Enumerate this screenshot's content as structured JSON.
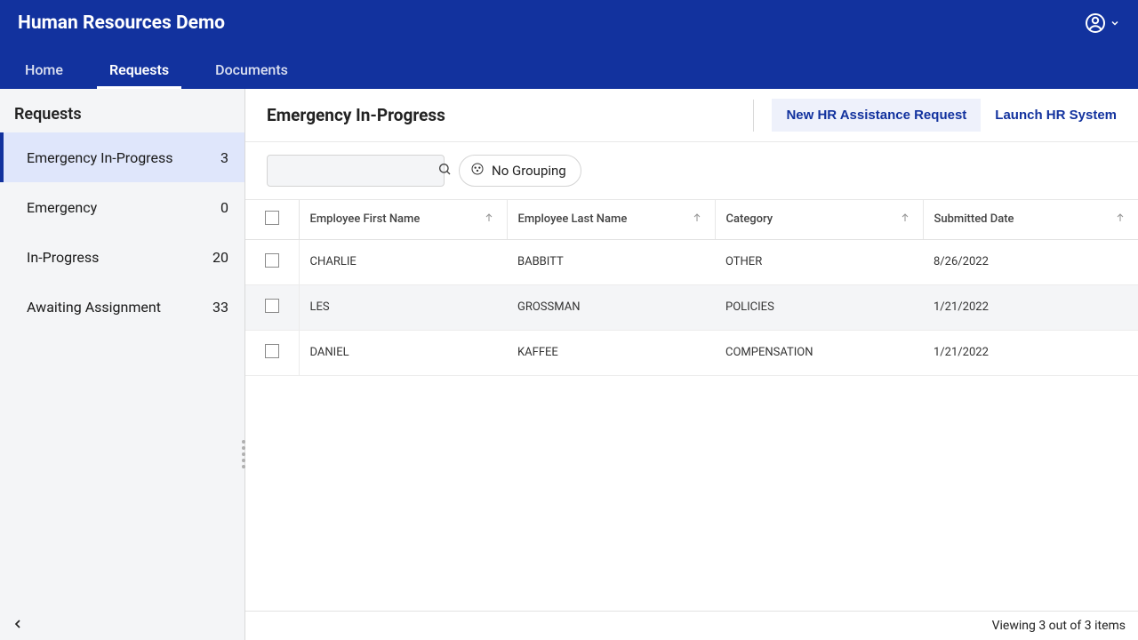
{
  "header": {
    "app_title": "Human Resources Demo"
  },
  "nav": {
    "items": [
      {
        "label": "Home",
        "active": false
      },
      {
        "label": "Requests",
        "active": true
      },
      {
        "label": "Documents",
        "active": false
      }
    ]
  },
  "sidebar": {
    "title": "Requests",
    "items": [
      {
        "label": "Emergency In-Progress",
        "count": "3",
        "active": true
      },
      {
        "label": "Emergency",
        "count": "0",
        "active": false
      },
      {
        "label": "In-Progress",
        "count": "20",
        "active": false
      },
      {
        "label": "Awaiting Assignment",
        "count": "33",
        "active": false
      }
    ]
  },
  "main": {
    "page_title": "Emergency In-Progress",
    "new_request_label": "New HR Assistance Request",
    "launch_label": "Launch HR System",
    "grouping_label": "No Grouping",
    "search_placeholder": ""
  },
  "table": {
    "columns": [
      {
        "label": "Employee First Name"
      },
      {
        "label": "Employee Last Name"
      },
      {
        "label": "Category"
      },
      {
        "label": "Submitted Date"
      }
    ],
    "rows": [
      {
        "first": "CHARLIE",
        "last": "BABBITT",
        "category": "OTHER",
        "date": "8/26/2022"
      },
      {
        "first": "LES",
        "last": "GROSSMAN",
        "category": "POLICIES",
        "date": "1/21/2022"
      },
      {
        "first": "DANIEL",
        "last": "KAFFEE",
        "category": "COMPENSATION",
        "date": "1/21/2022"
      }
    ]
  },
  "footer": {
    "status": "Viewing 3 out of 3 items"
  }
}
